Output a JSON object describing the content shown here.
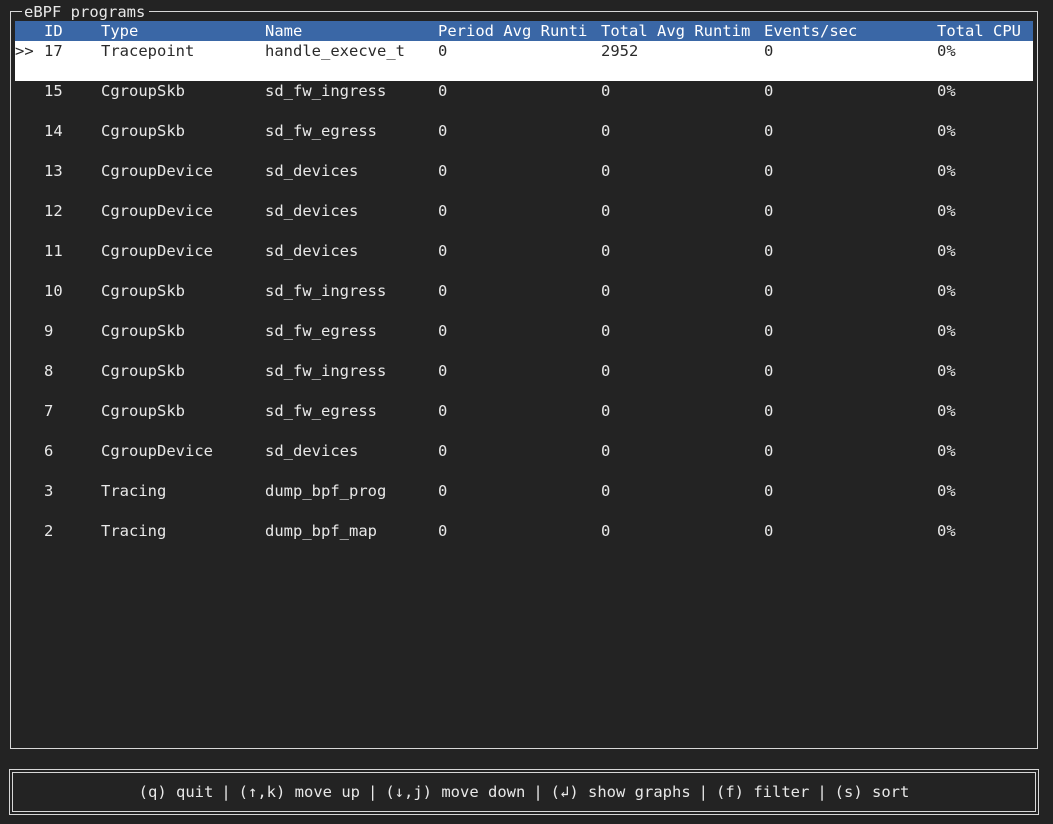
{
  "panel": {
    "title": "eBPF programs"
  },
  "table": {
    "columns": [
      "ID",
      "Type",
      "Name",
      "Period Avg Runti",
      "Total Avg Runtim",
      "Events/sec",
      "Total CPU"
    ],
    "selected_marker": ">>",
    "rows": [
      {
        "id": "17",
        "type": "Tracepoint",
        "name": "handle_execve_t",
        "period": "0",
        "total": "2952",
        "events": "0",
        "cpu": "0%",
        "selected": true
      },
      {
        "id": "15",
        "type": "CgroupSkb",
        "name": "sd_fw_ingress",
        "period": "0",
        "total": "0",
        "events": "0",
        "cpu": "0%"
      },
      {
        "id": "14",
        "type": "CgroupSkb",
        "name": "sd_fw_egress",
        "period": "0",
        "total": "0",
        "events": "0",
        "cpu": "0%"
      },
      {
        "id": "13",
        "type": "CgroupDevice",
        "name": "sd_devices",
        "period": "0",
        "total": "0",
        "events": "0",
        "cpu": "0%"
      },
      {
        "id": "12",
        "type": "CgroupDevice",
        "name": "sd_devices",
        "period": "0",
        "total": "0",
        "events": "0",
        "cpu": "0%"
      },
      {
        "id": "11",
        "type": "CgroupDevice",
        "name": "sd_devices",
        "period": "0",
        "total": "0",
        "events": "0",
        "cpu": "0%"
      },
      {
        "id": "10",
        "type": "CgroupSkb",
        "name": "sd_fw_ingress",
        "period": "0",
        "total": "0",
        "events": "0",
        "cpu": "0%"
      },
      {
        "id": "9",
        "type": "CgroupSkb",
        "name": "sd_fw_egress",
        "period": "0",
        "total": "0",
        "events": "0",
        "cpu": "0%"
      },
      {
        "id": "8",
        "type": "CgroupSkb",
        "name": "sd_fw_ingress",
        "period": "0",
        "total": "0",
        "events": "0",
        "cpu": "0%"
      },
      {
        "id": "7",
        "type": "CgroupSkb",
        "name": "sd_fw_egress",
        "period": "0",
        "total": "0",
        "events": "0",
        "cpu": "0%"
      },
      {
        "id": "6",
        "type": "CgroupDevice",
        "name": "sd_devices",
        "period": "0",
        "total": "0",
        "events": "0",
        "cpu": "0%"
      },
      {
        "id": "3",
        "type": "Tracing",
        "name": "dump_bpf_prog",
        "period": "0",
        "total": "0",
        "events": "0",
        "cpu": "0%"
      },
      {
        "id": "2",
        "type": "Tracing",
        "name": "dump_bpf_map",
        "period": "0",
        "total": "0",
        "events": "0",
        "cpu": "0%"
      }
    ]
  },
  "footer": {
    "separator": "|",
    "shortcuts": [
      {
        "name": "quit",
        "label": "(q) quit"
      },
      {
        "name": "move-up",
        "label": "(↑,k) move up"
      },
      {
        "name": "move-down",
        "label": "(↓,j) move down"
      },
      {
        "name": "show-graphs",
        "label": "(↲) show graphs"
      },
      {
        "name": "filter",
        "label": "(f) filter"
      },
      {
        "name": "sort",
        "label": "(s) sort"
      }
    ]
  },
  "colors": {
    "background": "#232323",
    "header_bg": "#3a67a6",
    "selected_bg": "#ffffff",
    "text": "#e8e8e8"
  }
}
